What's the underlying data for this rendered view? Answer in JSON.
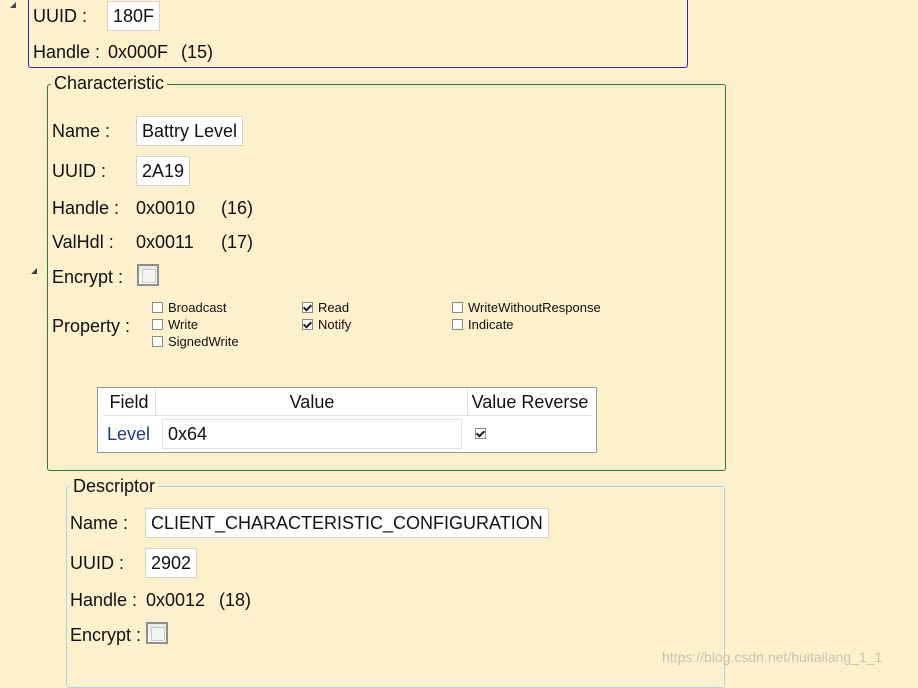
{
  "service": {
    "uuid_label": "UUID :",
    "uuid_value": "180F",
    "handle_label": "Handle :",
    "handle_value": "0x000F",
    "handle_num": "(15)"
  },
  "characteristic": {
    "legend": "Characteristic",
    "name_label": "Name :",
    "name_value": "Battry Level",
    "uuid_label": "UUID :",
    "uuid_value": "2A19",
    "handle_label": "Handle :",
    "handle_value": "0x0010",
    "handle_num": "(16)",
    "valhdl_label": "ValHdl :",
    "valhdl_value": "0x0011",
    "valhdl_num": "(17)",
    "encrypt_label": "Encrypt :",
    "encrypt_checked": false,
    "property_label": "Property :",
    "properties": [
      {
        "label": "Broadcast",
        "checked": false
      },
      {
        "label": "Write",
        "checked": false
      },
      {
        "label": "SignedWrite",
        "checked": false
      },
      {
        "label": "Read",
        "checked": true
      },
      {
        "label": "Notify",
        "checked": true
      },
      {
        "label": "WriteWithoutResponse",
        "checked": false
      },
      {
        "label": "Indicate",
        "checked": false
      }
    ],
    "grid": {
      "headers": [
        "Field",
        "Value",
        "Value Reverse"
      ],
      "rows": [
        {
          "field": "Level",
          "value": "0x64",
          "reverse": true
        }
      ]
    }
  },
  "descriptor": {
    "legend": "Descriptor",
    "name_label": "Name :",
    "name_value": "CLIENT_CHARACTERISTIC_CONFIGURATION",
    "uuid_label": "UUID :",
    "uuid_value": "2902",
    "handle_label": "Handle :",
    "handle_value": "0x0012",
    "handle_num": "(18)",
    "encrypt_label": "Encrypt :",
    "encrypt_checked": false
  },
  "watermark": "https://blog.csdn.net/huitailang_1_1",
  "colors": {
    "background": "#fdf0cc",
    "service_border": "#2b2bb0",
    "characteristic_border": "#2e7d32",
    "descriptor_border": "#a8d4e6",
    "field_text": "#1f3a8a"
  }
}
